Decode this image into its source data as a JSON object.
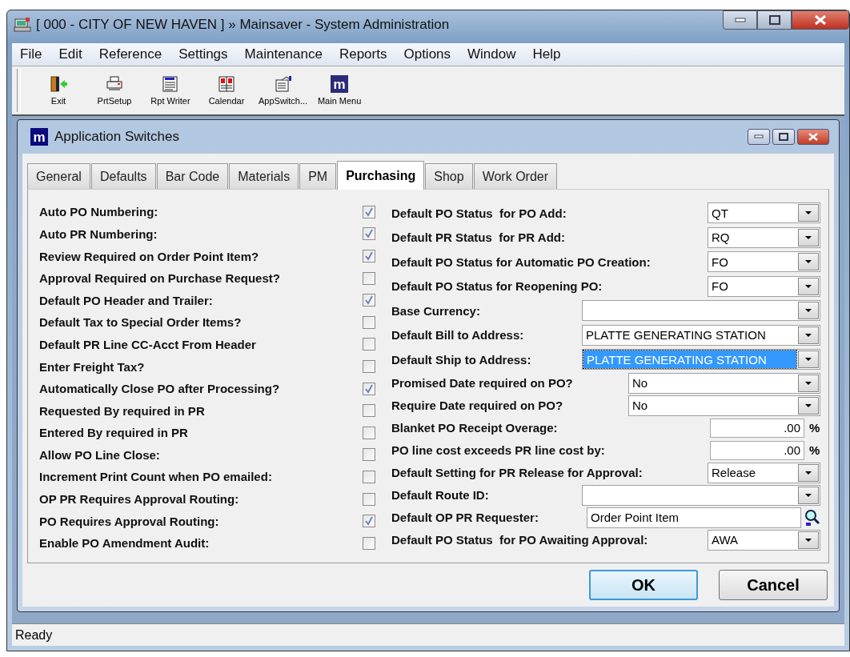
{
  "window": {
    "title": "[ 000 - CITY OF NEW HAVEN ] » Mainsaver - System Administration"
  },
  "menu": [
    "File",
    "Edit",
    "Reference",
    "Settings",
    "Maintenance",
    "Reports",
    "Options",
    "Window",
    "Help"
  ],
  "toolbar": [
    {
      "kind": "door",
      "label": "Exit"
    },
    {
      "kind": "printer",
      "label": "PrtSetup"
    },
    {
      "kind": "report",
      "label": "Rpt Writer"
    },
    {
      "kind": "calendar",
      "label": "Calendar"
    },
    {
      "kind": "switch",
      "label": "AppSwitch..."
    },
    {
      "kind": "logo",
      "glyph": "m",
      "label": "Main Menu"
    }
  ],
  "dialog": {
    "icon_glyph": "m",
    "title": "Application Switches",
    "tabs": [
      {
        "label": "General",
        "selected": false
      },
      {
        "label": "Defaults",
        "selected": false
      },
      {
        "label": "Bar Code",
        "selected": false
      },
      {
        "label": "Materials",
        "selected": false
      },
      {
        "label": "PM",
        "selected": false
      },
      {
        "label": "Purchasing",
        "selected": true
      },
      {
        "label": "Shop",
        "selected": false
      },
      {
        "label": "Work Order",
        "selected": false
      }
    ],
    "switches": [
      {
        "label": "Auto PO Numbering:",
        "checked": true
      },
      {
        "label": "Auto PR Numbering:",
        "checked": true
      },
      {
        "label": "Review Required on Order Point Item?",
        "checked": true
      },
      {
        "label": "Approval Required on Purchase Request?",
        "checked": false
      },
      {
        "label": "Default PO Header and Trailer:",
        "checked": true
      },
      {
        "label": "Default Tax to Special Order Items?",
        "checked": false
      },
      {
        "label": "Default PR Line CC-Acct From Header",
        "checked": false
      },
      {
        "label": "Enter Freight Tax?",
        "checked": false
      },
      {
        "label": "Automatically Close PO after Processing?",
        "checked": true
      },
      {
        "label": "Requested By required in PR",
        "checked": false
      },
      {
        "label": "Entered By required in PR",
        "checked": false
      },
      {
        "label": "Allow PO Line Close:",
        "checked": false
      },
      {
        "label": "Increment Print Count when PO emailed:",
        "checked": false
      },
      {
        "label": "OP PR Requires Approval Routing:",
        "checked": false
      },
      {
        "label": "PO Requires Approval Routing:",
        "checked": true
      },
      {
        "label": "Enable PO Amendment Audit:",
        "checked": false
      }
    ],
    "settings": [
      {
        "label": "Default PO Status  for PO Add:",
        "kind": "code",
        "value": "QT",
        "highlighted": false
      },
      {
        "label": "Default PR Status  for PR Add:",
        "kind": "code",
        "value": "RQ",
        "highlighted": false
      },
      {
        "label": "Default PO Status for Automatic PO Creation:",
        "kind": "code",
        "value": "FO",
        "highlighted": false
      },
      {
        "label": "Default PO Status for Reopening PO:",
        "kind": "code",
        "value": "FO",
        "highlighted": false
      },
      {
        "label": "Base Currency:",
        "kind": "address",
        "highlighted": false
      },
      {
        "label": "Default Bill to Address:",
        "kind": "address",
        "value": "PLATTE GENERATING STATION",
        "highlighted": false
      },
      {
        "label": "Default Ship to Address:",
        "kind": "address",
        "value": "PLATTE GENERATING STATION",
        "highlighted": true
      },
      {
        "label": "Promised Date required on PO?",
        "kind": "choice",
        "value": "No",
        "highlighted": false
      },
      {
        "label": "Require Date required on PO?",
        "kind": "choice",
        "value": "No",
        "highlighted": false
      },
      {
        "label": "Blanket PO Receipt Overage:",
        "kind": "percent",
        "value": ".00",
        "unit": "%",
        "highlighted": false
      },
      {
        "label": "PO line cost exceeds PR line cost by:",
        "kind": "percent",
        "value": ".00",
        "unit": "%",
        "highlighted": false
      },
      {
        "label": "Default Setting for PR Release for Approval:",
        "kind": "code",
        "value": "Release",
        "highlighted": false
      },
      {
        "label": "Default Route ID:",
        "kind": "address",
        "highlighted": false
      },
      {
        "label": "Default OP PR Requester:",
        "kind": "lookup",
        "value": "Order Point Item",
        "highlighted": false
      },
      {
        "label": "Default PO Status  for PO Awaiting Approval:",
        "kind": "code",
        "value": "AWA",
        "highlighted": false
      }
    ],
    "buttons": [
      {
        "label": "OK",
        "default": true
      },
      {
        "label": "Cancel",
        "default": false
      }
    ]
  },
  "status_bar": "Ready"
}
